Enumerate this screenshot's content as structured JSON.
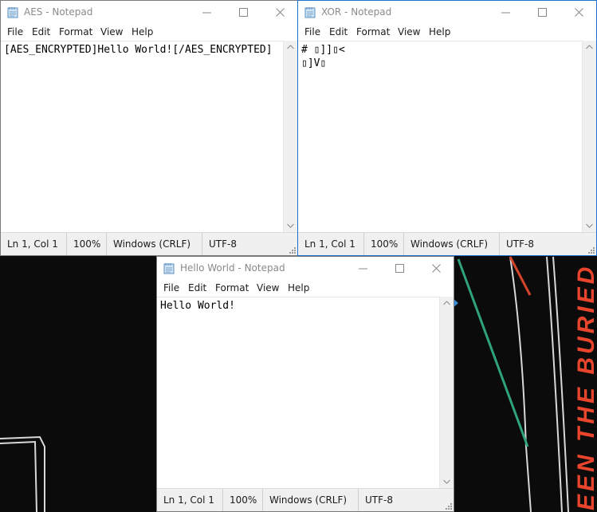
{
  "windows": {
    "aes": {
      "title": "AES - Notepad",
      "content": "[AES_ENCRYPTED]Hello World![/AES_ENCRYPTED]",
      "status": {
        "position": "Ln 1, Col 1",
        "zoom": "100%",
        "line_endings": "Windows (CRLF)",
        "encoding": "UTF-8"
      }
    },
    "xor": {
      "title": "XOR - Notepad",
      "content": "# ▯]]▯<\n▯]V▯",
      "status": {
        "position": "Ln 1, Col 1",
        "zoom": "100%",
        "line_endings": "Windows (CRLF)",
        "encoding": "UTF-8"
      }
    },
    "hello": {
      "title": "Hello World - Notepad",
      "content": "Hello World!",
      "status": {
        "position": "Ln 1, Col 1",
        "zoom": "100%",
        "line_endings": "Windows (CRLF)",
        "encoding": "UTF-8"
      }
    }
  },
  "menu": {
    "file": "File",
    "edit": "Edit",
    "format": "Format",
    "view": "View",
    "help": "Help"
  },
  "background": {
    "wallpaper_text": "EEN THE BURIED",
    "accent_text_color": "#e8452c",
    "line_color": "#2fa37a"
  },
  "icons": [
    "notepad-icon",
    "minimize-icon",
    "maximize-icon",
    "close-icon",
    "scroll-up-icon",
    "scroll-down-icon",
    "resize-grip-icon"
  ]
}
